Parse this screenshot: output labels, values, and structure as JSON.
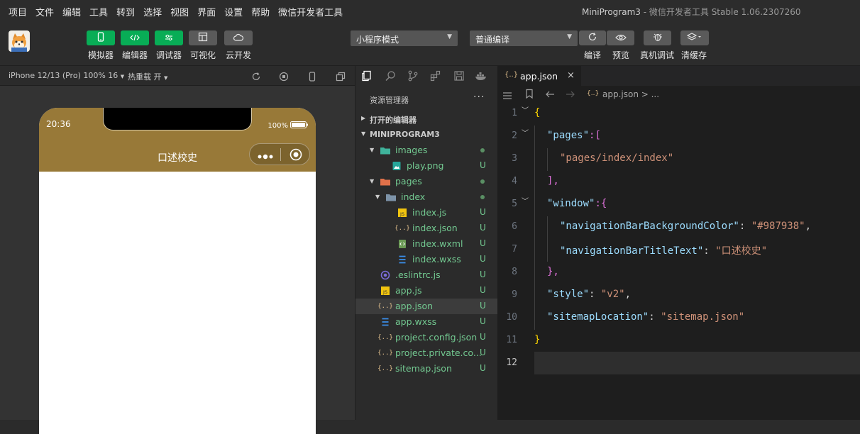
{
  "menu": [
    "项目",
    "文件",
    "编辑",
    "工具",
    "转到",
    "选择",
    "视图",
    "界面",
    "设置",
    "帮助",
    "微信开发者工具"
  ],
  "window_title": {
    "app": "MiniProgram3",
    "sep": " - ",
    "product": "微信开发者工具 Stable 1.06.2307260"
  },
  "toolbar": {
    "left_buttons": [
      {
        "label": "模拟器",
        "icon": "phone-icon"
      },
      {
        "label": "编辑器",
        "icon": "code-icon"
      },
      {
        "label": "调试器",
        "icon": "debug-sliders-icon"
      },
      {
        "label": "可视化",
        "icon": "layout-icon"
      },
      {
        "label": "云开发",
        "icon": "cloud-icon"
      }
    ],
    "mode_select": "小程序模式",
    "compile_select": "普通编译",
    "right_buttons": [
      {
        "label": "编译",
        "icon": "refresh-icon"
      },
      {
        "label": "预览",
        "icon": "eye-icon"
      },
      {
        "label": "真机调试",
        "icon": "bug-icon"
      },
      {
        "label": "清缓存",
        "icon": "layers-icon"
      }
    ]
  },
  "simulator": {
    "device": "iPhone 12/13 (Pro) 100% 16",
    "hot_reload": "热重载 开",
    "status_time": "20:36",
    "battery": "100%",
    "nav_title": "口述校史",
    "nav_color": "#987938"
  },
  "explorer": {
    "title": "资源管理器",
    "more": "···",
    "open_editors": "打开的编辑器",
    "project": "MINIPROGRAM3",
    "tree": [
      {
        "name": "images",
        "type": "folder",
        "depth": 0,
        "status": "dot"
      },
      {
        "name": "play.png",
        "type": "png",
        "depth": 1,
        "status": "U"
      },
      {
        "name": "pages",
        "type": "folder",
        "depth": 0,
        "status": "dot"
      },
      {
        "name": "index",
        "type": "folder",
        "depth": 1,
        "status": "dot"
      },
      {
        "name": "index.js",
        "type": "js",
        "depth": 2,
        "status": "U"
      },
      {
        "name": "index.json",
        "type": "json",
        "depth": 2,
        "status": "U"
      },
      {
        "name": "index.wxml",
        "type": "wxml",
        "depth": 2,
        "status": "U"
      },
      {
        "name": "index.wxss",
        "type": "wxss",
        "depth": 2,
        "status": "U"
      },
      {
        "name": ".eslintrc.js",
        "type": "eslint",
        "depth": 0,
        "status": "U"
      },
      {
        "name": "app.js",
        "type": "js",
        "depth": 0,
        "status": "U"
      },
      {
        "name": "app.json",
        "type": "json",
        "depth": 0,
        "status": "U",
        "selected": true
      },
      {
        "name": "app.wxss",
        "type": "wxss",
        "depth": 0,
        "status": "U"
      },
      {
        "name": "project.config.json",
        "type": "json",
        "depth": 0,
        "status": "U"
      },
      {
        "name": "project.private.co...",
        "type": "json",
        "depth": 0,
        "status": "U"
      },
      {
        "name": "sitemap.json",
        "type": "json",
        "depth": 0,
        "status": "U"
      }
    ]
  },
  "editor": {
    "tab": "app.json",
    "breadcrumb": "app.json > ...",
    "line_numbers": [
      "1",
      "2",
      "3",
      "4",
      "5",
      "6",
      "7",
      "8",
      "9",
      "10",
      "11",
      "12"
    ],
    "code": {
      "l1": "{",
      "l2_key": "\"pages\"",
      "l2_rest": ":[",
      "l3": "\"pages/index/index\"",
      "l4": "],",
      "l5_key": "\"window\"",
      "l5_rest": ":{",
      "l6_key": "\"navigationBarBackgroundColor\"",
      "l6_val": "\"#987938\"",
      "l7_key": "\"navigationBarTitleText\"",
      "l7_val": "\"口述校史\"",
      "l8": "},",
      "l9_key": "\"style\"",
      "l9_val": "\"v2\"",
      "l10_key": "\"sitemapLocation\"",
      "l10_val": "\"sitemap.json\"",
      "l11": "}"
    }
  }
}
